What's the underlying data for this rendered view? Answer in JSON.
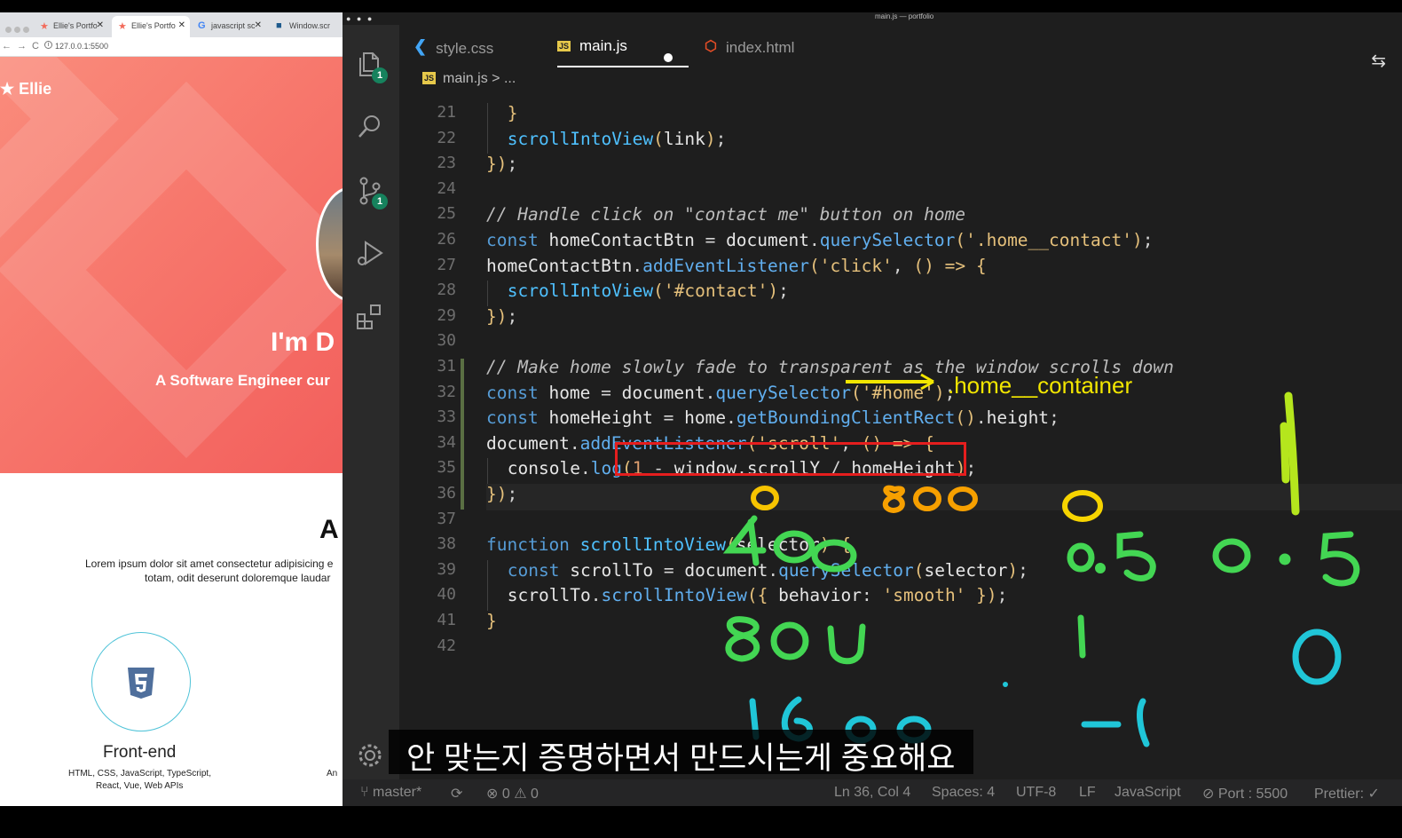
{
  "browser": {
    "tabs": [
      {
        "label": "Ellie's Portfo",
        "icon": "star-icon"
      },
      {
        "label": "Ellie's Portfo",
        "icon": "star-icon"
      },
      {
        "label": "javascript sc",
        "icon": "google-icon"
      },
      {
        "label": "Window.scr",
        "icon": "mdn-icon"
      }
    ],
    "url": "127.0.0.1:5500",
    "site": {
      "logo": "Ellie",
      "hero_title": "I'm D",
      "hero_subtitle": "A Software Engineer cur",
      "about_heading": "A",
      "lorem_line1": "Lorem ipsum dolor sit amet consectetur adipisicing e",
      "lorem_line2": "totam, odit deserunt doloremque laudar",
      "skill_title": "Front-end",
      "skill_desc_line1": "HTML, CSS, JavaScript, TypeScript,",
      "skill_desc_line2": "React, Vue, Web APIs",
      "skill_desc_right": "An"
    }
  },
  "editor": {
    "window_title": "main.js — portfolio",
    "tabs": [
      {
        "label": "style.css",
        "icon": "css-icon"
      },
      {
        "label": "main.js",
        "icon": "js-icon",
        "active": true,
        "modified": true
      },
      {
        "label": "index.html",
        "icon": "html-icon"
      }
    ],
    "breadcrumb": {
      "file": "main.js",
      "sep": ">",
      "rest": "..."
    },
    "activity_badges": {
      "explorer": "1",
      "source_control": "1"
    },
    "code_lines": [
      {
        "n": "21",
        "indent": 1,
        "text": "}"
      },
      {
        "n": "22",
        "indent": 1,
        "text": "scrollIntoView(link);"
      },
      {
        "n": "23",
        "indent": 0,
        "text": "});"
      },
      {
        "n": "24",
        "indent": 0,
        "text": ""
      },
      {
        "n": "25",
        "indent": 0,
        "text": "// Handle click on \"contact me\" button on home"
      },
      {
        "n": "26",
        "indent": 0,
        "text": "const homeContactBtn = document.querySelector('.home__contact');"
      },
      {
        "n": "27",
        "indent": 0,
        "text": "homeContactBtn.addEventListener('click', () => {"
      },
      {
        "n": "28",
        "indent": 1,
        "text": "scrollIntoView('#contact');"
      },
      {
        "n": "29",
        "indent": 0,
        "text": "});"
      },
      {
        "n": "30",
        "indent": 0,
        "text": ""
      },
      {
        "n": "31",
        "indent": 0,
        "text": "// Make home slowly fade to transparent as the window scrolls down"
      },
      {
        "n": "32",
        "indent": 0,
        "text": "const home = document.querySelector('#home');"
      },
      {
        "n": "33",
        "indent": 0,
        "text": "const homeHeight = home.getBoundingClientRect().height;"
      },
      {
        "n": "34",
        "indent": 0,
        "text": "document.addEventListener('scroll', () => {"
      },
      {
        "n": "35",
        "indent": 1,
        "text": "console.log(1 - window.scrollY / homeHeight);"
      },
      {
        "n": "36",
        "indent": 0,
        "text": "});"
      },
      {
        "n": "37",
        "indent": 0,
        "text": ""
      },
      {
        "n": "38",
        "indent": 0,
        "text": "function scrollIntoView(selector) {"
      },
      {
        "n": "39",
        "indent": 1,
        "text": "const scrollTo = document.querySelector(selector);"
      },
      {
        "n": "40",
        "indent": 1,
        "text": "scrollTo.scrollIntoView({ behavior: 'smooth' });"
      },
      {
        "n": "41",
        "indent": 0,
        "text": "}"
      },
      {
        "n": "42",
        "indent": 0,
        "text": ""
      }
    ],
    "annotation_text": ".home__container",
    "handwritten_notes": [
      "0",
      "800",
      "400",
      "800",
      "1600",
      "0",
      "0.5",
      "0.5",
      "1",
      "0",
      "-1"
    ],
    "status_bar": {
      "branch": "master*",
      "errors": "0",
      "warnings": "0",
      "position": "Ln 36, Col 4",
      "spaces": "Spaces: 4",
      "encoding": "UTF-8",
      "eol": "LF",
      "language": "JavaScript",
      "port": "Port : 5500",
      "prettier": "Prettier: ✓"
    }
  },
  "subtitle": "안 맞는지 증명하면서 만드시는게 중요해요"
}
